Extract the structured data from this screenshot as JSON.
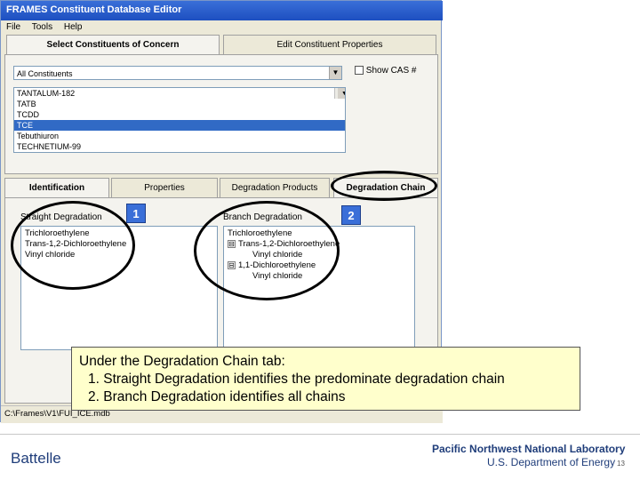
{
  "window": {
    "title": "FRAMES Constituent Database Editor",
    "menu": [
      "File",
      "Tools",
      "Help"
    ]
  },
  "top_tabs": [
    "Select Constituents of Concern",
    "Edit Constituent Properties"
  ],
  "constituent_filter": {
    "selected": "All Constituents"
  },
  "show_cas": {
    "label": "Show CAS #"
  },
  "constituent_list": {
    "items": [
      "TANTALUM-182",
      "TATB",
      "TCDD",
      "TCE",
      "Tebuthiuron",
      "TECHNETIUM-99"
    ],
    "selected_index": 3
  },
  "property_tabs": [
    "Identification",
    "Properties",
    "Degradation Products",
    "Degradation Chain"
  ],
  "straight_degradation": {
    "label": "Straight Degradation",
    "items": [
      "Trichloroethylene",
      "Trans-1,2-Dichloroethylene",
      "Vinyl chloride"
    ]
  },
  "branch_degradation": {
    "label": "Branch Degradation",
    "root": "Trichloroethylene",
    "branches": [
      {
        "expander": "⊟",
        "name": "Trans-1,2-Dichloroethylene",
        "child": "Vinyl chloride"
      },
      {
        "expander": "⊟",
        "name": "1,1-Dichloroethylene",
        "child": "Vinyl chloride"
      }
    ]
  },
  "markers": [
    "1",
    "2"
  ],
  "callout": {
    "heading": "Under the Degradation Chain tab:",
    "lines": [
      "1.  Straight Degradation identifies the predominate degradation chain",
      "2.  Branch Degradation identifies all chains"
    ]
  },
  "status_bar": {
    "path": "C:\\Frames\\V1\\FUI_ICE.mdb"
  },
  "footer": {
    "left_logo": "Battelle",
    "lab_name": "Pacific Northwest National Laboratory",
    "department": "U.S. Department of Energy",
    "page_number": "13"
  },
  "colors": {
    "title_bar": "#1d4fc0",
    "selection": "#316ac5",
    "callout_bg": "#ffffcc",
    "marker": "#3a6fd8",
    "lab_text": "#1f3d7a"
  }
}
